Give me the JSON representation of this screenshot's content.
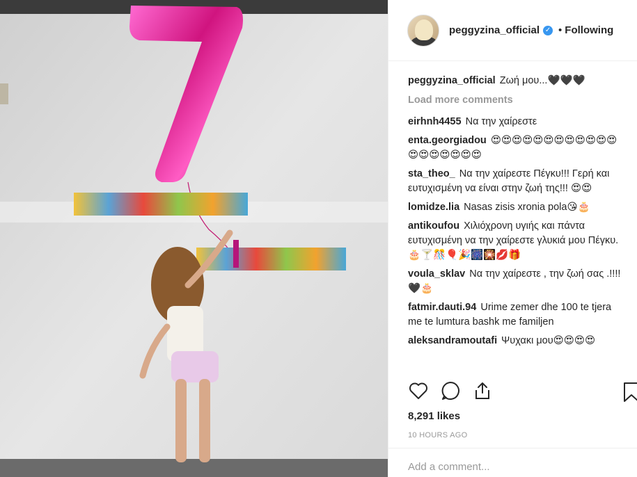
{
  "post": {
    "username": "peggyzina_official",
    "verified_mark": "✓",
    "separator": "•",
    "follow_label": "Following"
  },
  "caption": {
    "user": "peggyzina_official",
    "text": "Ζωή μου...🖤🖤🖤"
  },
  "load_more": "Load more comments",
  "comments": [
    {
      "user": "eirhnh4455",
      "text": "Να την χαίρεστε"
    },
    {
      "user": "enta.georgiadou",
      "text": "😍😍😍😍😍😍😍😍😍😍😍😍😍😍😍😍😍😍😍"
    },
    {
      "user": "sta_theo_",
      "text": "Να την χαίρεστε Πέγκυ!!! Γερή και ευτυχισμένη να είναι στην ζωή της!!! 😍😍"
    },
    {
      "user": "lomidze.lia",
      "text": "Nasas zisis xronia pola😘🎂"
    },
    {
      "user": "antikoufou",
      "text": "Χιλιόχρονη υγιής και πάντα ευτυχισμένη να την χαίρεστε γλυκιά μου Πέγκυ.🎂🍸🎊🎈🎉🎆🎇💋🎁"
    },
    {
      "user": "voula_sklav",
      "text": "Να την χαίρεστε , την ζωή σας .!!!!🖤🎂"
    },
    {
      "user": "fatmir.dauti.94",
      "text": "Urime zemer dhe 100 te tjera me te lumtura bashk me familjen"
    },
    {
      "user": "aleksandramoutafi",
      "text": "Ψυχακι μου😍😍😍😍"
    }
  ],
  "icons": {
    "like": "heart-icon",
    "comment": "comment-icon",
    "share": "share-icon",
    "save": "bookmark-icon"
  },
  "likes": "8,291 likes",
  "time": "10 HOURS AGO",
  "add_comment_placeholder": "Add a comment..."
}
